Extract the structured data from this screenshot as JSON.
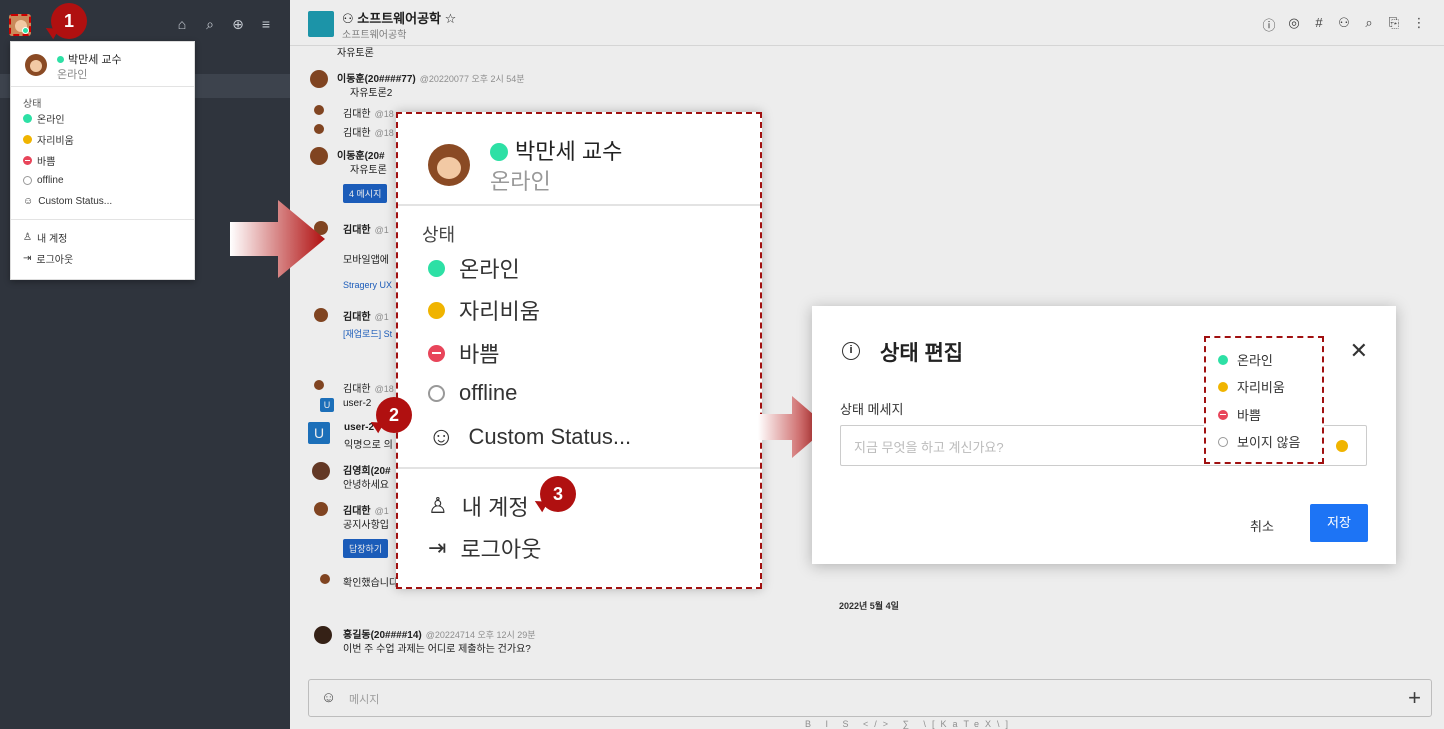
{
  "sidebar": {
    "top_icons": [
      "home-icon",
      "search-icon",
      "globe-icon",
      "sort-icon"
    ]
  },
  "user_menu": {
    "name": "박만세 교수",
    "status_text": "온라인",
    "status_heading": "상태",
    "statuses": [
      {
        "label": "온라인",
        "kind": "online"
      },
      {
        "label": "자리비움",
        "kind": "away"
      },
      {
        "label": "바쁨",
        "kind": "busy"
      },
      {
        "label": "offline",
        "kind": "offline"
      },
      {
        "label": "Custom Status...",
        "kind": "custom"
      }
    ],
    "account_label": "내 계정",
    "logout_label": "로그아웃"
  },
  "badges": [
    "1",
    "2",
    "3"
  ],
  "room": {
    "title": "소프트웨어공학",
    "subtitle": "소프트웨어공학",
    "star": "☆"
  },
  "messages": {
    "m0_text": "자유토론",
    "m1_name": "이동훈(20####77)",
    "m1_meta": "@20220077 오후 2시 54분",
    "m1_text": "자유토론2",
    "m2_name": "김대한",
    "m2_meta": "@18",
    "m3_name": "김대한",
    "m3_meta": "@18",
    "m4_name": "이동훈(20#",
    "m4_text": "자유토론",
    "m4_button": "4 메시지",
    "m5_name": "김대한",
    "m5_meta": "@1",
    "m5_text": "모바일앱에",
    "m5_link": "Stragery UX",
    "m6_name": "김대한",
    "m6_meta": "@1",
    "m6_link": "[재업로드] St",
    "m7_name": "김대한",
    "m7_meta": "@18",
    "m8_name": "user-2",
    "m8_avatar": "U",
    "m9_name": "user-2",
    "m9_avatar": "U",
    "m9_text": "익명으로 의",
    "m10_name": "김영희(20#",
    "m10_text": "안녕하세요",
    "m11_name": "김대한",
    "m11_meta": "@1",
    "m11_text": "공지사항입",
    "m11_button": "답장하기",
    "m12_text": "확인했습니다",
    "date_divider": "2022년 5월 4일",
    "m13_name": "홍길동(20####14)",
    "m13_meta": "@20224714 오후 12시 29분",
    "m13_text": "이번 주 수업 과제는 어디로 제출하는 건가요?"
  },
  "composer": {
    "placeholder": "메시지",
    "format_bar": "B I S </> ∑ \\[KaTeX\\]"
  },
  "modal": {
    "title": "상태 편집",
    "field_label": "상태 메세지",
    "placeholder": "지금 무엇을 하고 계신가요?",
    "cancel_label": "취소",
    "save_label": "저장",
    "status_options": [
      {
        "label": "온라인",
        "kind": "online"
      },
      {
        "label": "자리비움",
        "kind": "away"
      },
      {
        "label": "바쁨",
        "kind": "busy"
      },
      {
        "label": "보이지 않음",
        "kind": "offline"
      }
    ]
  },
  "colors": {
    "online": "#2de0a5",
    "away": "#f0b400",
    "busy": "#e8455a",
    "primary": "#1d74f5",
    "callout": "#a01010"
  }
}
